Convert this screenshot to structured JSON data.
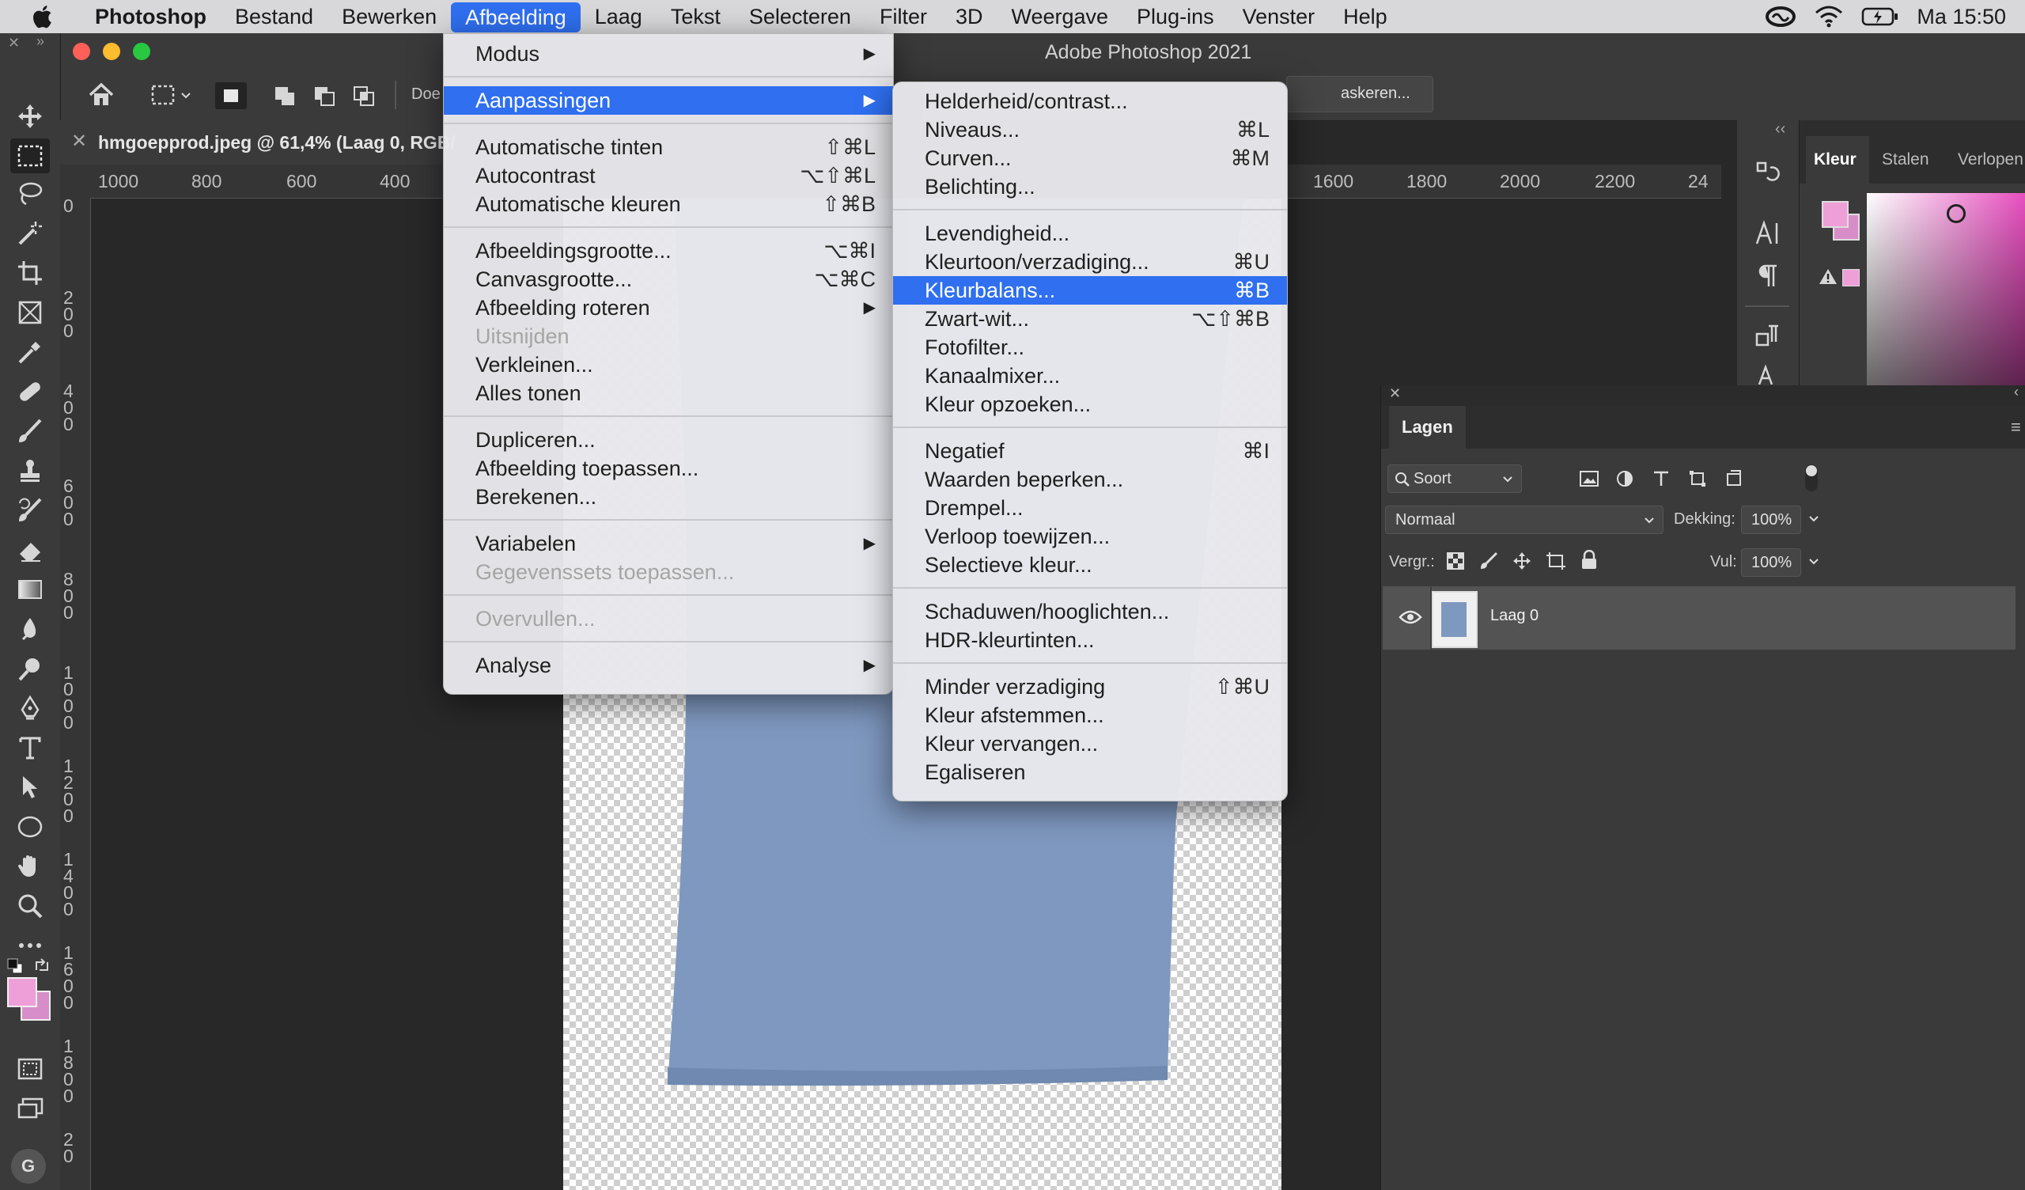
{
  "menubar": {
    "app": "Photoshop",
    "items": [
      "Bestand",
      "Bewerken",
      "Afbeelding",
      "Laag",
      "Tekst",
      "Selecteren",
      "Filter",
      "3D",
      "Weergave",
      "Plug-ins",
      "Venster",
      "Help"
    ],
    "active": "Afbeelding",
    "clock": "Ma 15:50",
    "status_icons": [
      "creative-cloud-icon",
      "wifi-icon",
      "battery-icon"
    ]
  },
  "window": {
    "title": "Adobe Photoshop 2021"
  },
  "options_bar": {
    "truncated_left": "Doe",
    "truncated_right": "askeren..."
  },
  "document": {
    "tab_title": "hmgoepprod.jpeg @ 61,4% (Laag 0, RGB/",
    "ruler_h": [
      "1000",
      "800",
      "600",
      "400",
      "1600",
      "1800",
      "2000",
      "2200",
      "24"
    ],
    "ruler_v": [
      "0",
      "2\n0\n0",
      "4\n0\n0",
      "6\n0\n0",
      "8\n0\n0",
      "1\n0\n0\n0",
      "1\n2\n0\n0",
      "1\n4\n0\n0",
      "1\n6\n0\n0",
      "1\n8\n0\n0",
      "2\n0"
    ]
  },
  "image_menu": {
    "items": [
      {
        "label": "Modus",
        "submenu": true
      },
      {
        "label": "Aanpassingen",
        "submenu": true,
        "highlighted": true
      },
      {
        "label": "Automatische tinten",
        "shortcut": "⇧⌘L"
      },
      {
        "label": "Autocontrast",
        "shortcut": "⌥⇧⌘L"
      },
      {
        "label": "Automatische kleuren",
        "shortcut": "⇧⌘B"
      },
      {
        "label": "Afbeeldingsgrootte...",
        "shortcut": "⌥⌘I"
      },
      {
        "label": "Canvasgrootte...",
        "shortcut": "⌥⌘C"
      },
      {
        "label": "Afbeelding roteren",
        "submenu": true
      },
      {
        "label": "Uitsnijden",
        "disabled": true
      },
      {
        "label": "Verkleinen..."
      },
      {
        "label": "Alles tonen"
      },
      {
        "label": "Dupliceren..."
      },
      {
        "label": "Afbeelding toepassen..."
      },
      {
        "label": "Berekenen..."
      },
      {
        "label": "Variabelen",
        "submenu": true
      },
      {
        "label": "Gegevenssets toepassen...",
        "disabled": true
      },
      {
        "label": "Overvullen...",
        "disabled": true
      },
      {
        "label": "Analyse",
        "submenu": true
      }
    ]
  },
  "adjustments_menu": {
    "items": [
      {
        "label": "Helderheid/contrast..."
      },
      {
        "label": "Niveaus...",
        "shortcut": "⌘L"
      },
      {
        "label": "Curven...",
        "shortcut": "⌘M"
      },
      {
        "label": "Belichting..."
      },
      {
        "label": "Levendigheid..."
      },
      {
        "label": "Kleurtoon/verzadiging...",
        "shortcut": "⌘U"
      },
      {
        "label": "Kleurbalans...",
        "shortcut": "⌘B",
        "highlighted": true
      },
      {
        "label": "Zwart-wit...",
        "shortcut": "⌥⇧⌘B"
      },
      {
        "label": "Fotofilter..."
      },
      {
        "label": "Kanaalmixer..."
      },
      {
        "label": "Kleur opzoeken..."
      },
      {
        "label": "Negatief",
        "shortcut": "⌘I"
      },
      {
        "label": "Waarden beperken..."
      },
      {
        "label": "Drempel..."
      },
      {
        "label": "Verloop toewijzen..."
      },
      {
        "label": "Selectieve kleur..."
      },
      {
        "label": "Schaduwen/hooglichten..."
      },
      {
        "label": "HDR-kleurtinten..."
      },
      {
        "label": "Minder verzadiging",
        "shortcut": "⇧⌘U"
      },
      {
        "label": "Kleur afstemmen..."
      },
      {
        "label": "Kleur vervangen..."
      },
      {
        "label": "Egaliseren"
      }
    ]
  },
  "color_panel": {
    "tabs": [
      "Kleur",
      "Stalen",
      "Verlopen"
    ],
    "foreground": "#ee9fd8",
    "background": "#d78ec8"
  },
  "layers_panel": {
    "tab": "Lagen",
    "filter_label": "Soort",
    "blend_mode": "Normaal",
    "opacity_label": "Dekking:",
    "opacity": "100%",
    "lock_label": "Vergr.:",
    "fill_label": "Vul:",
    "fill": "100%",
    "layers": [
      {
        "name": "Laag 0",
        "visible": true
      }
    ]
  },
  "colors": {
    "menu_highlight": "#2f6ff0",
    "garment": "#7f98bf"
  }
}
